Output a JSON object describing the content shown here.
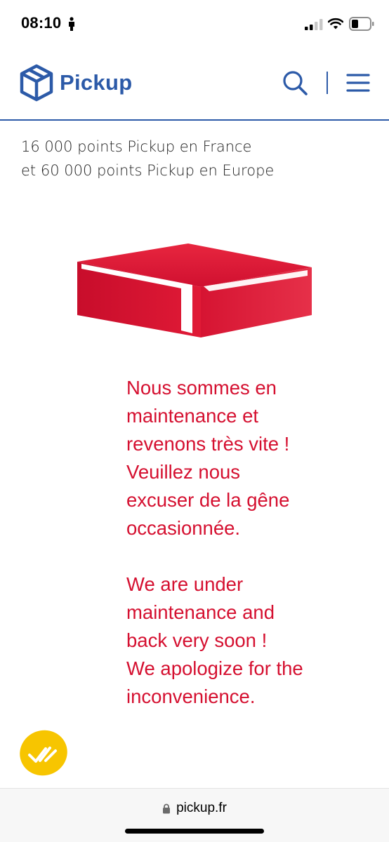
{
  "status_bar": {
    "time": "08:10",
    "icons": [
      "person-icon",
      "signal-icon",
      "wifi-icon",
      "battery-icon"
    ]
  },
  "header": {
    "brand": "Pickup",
    "brand_color": "#2c5aa8",
    "logo_icon": "cube-icon",
    "search_icon": "search-icon",
    "menu_icon": "hamburger-menu-icon"
  },
  "intro": {
    "line1": "16 000 points Pickup en France",
    "line2": "et 60 000 points Pickup en Europe"
  },
  "illustration": {
    "icon": "red-parcel-box-icon",
    "color": "#d51030"
  },
  "message": {
    "color": "#d51030",
    "french": "Nous sommes en\nmaintenance et\nrevenons très vite !\nVeuillez nous\nexcuser de la gêne\noccasionnée.",
    "english": "We are under\nmaintenance and\nback very soon !\nWe apologize for the\ninconvenience."
  },
  "feedback_badge": {
    "icon": "double-check-icon",
    "color": "#f7c500"
  },
  "browser": {
    "url": "pickup.fr",
    "lock_icon": "lock-icon"
  }
}
